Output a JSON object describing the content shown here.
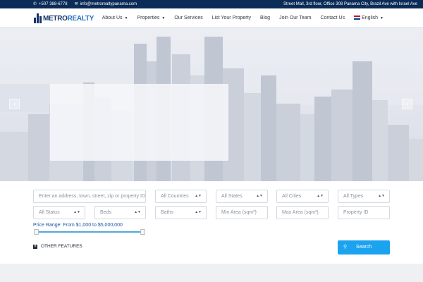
{
  "topbar": {
    "phone": "+507 388-6778",
    "email": "info@metrorealtypanama.com",
    "address": "Street Mall, 3rd floor, Office 308 Panama City, Brazil Ave with Israel Ave"
  },
  "brand": {
    "logo_part1": "METRO",
    "logo_part2": "REALTY"
  },
  "nav": {
    "items": [
      {
        "label": "About Us",
        "has_dropdown": true
      },
      {
        "label": "Properties",
        "has_dropdown": true
      },
      {
        "label": "Our Services",
        "has_dropdown": false
      },
      {
        "label": "List Your Property",
        "has_dropdown": false
      },
      {
        "label": "Blog",
        "has_dropdown": false
      },
      {
        "label": "Join Our Team",
        "has_dropdown": false
      },
      {
        "label": "Contact Us",
        "has_dropdown": false
      }
    ],
    "language": "English"
  },
  "search": {
    "keyword_placeholder": "Enter an address, town, street, zip or property ID",
    "countries": "All Countries",
    "states": "All States",
    "cities": "All Cities",
    "types": "All Types",
    "status": "All Status",
    "beds": "Beds",
    "baths": "Baths",
    "min_area": "Min Area (sqm²)",
    "max_area": "Max Area (sqm²)",
    "property_id": "Property ID",
    "price_range": "Price Range: From $1,000 to $5,000,000",
    "other_features": "OTHER FEATURES",
    "search_label": "Search"
  },
  "icons": {
    "phone": "phone-icon",
    "email": "envelope-icon",
    "prev": "chevron-left-icon",
    "next": "chevron-right-icon",
    "search": "magnifier-icon"
  },
  "colors": {
    "topbar": "#0b2c57",
    "accent": "#1ba3f0",
    "brand": "#14356b"
  }
}
